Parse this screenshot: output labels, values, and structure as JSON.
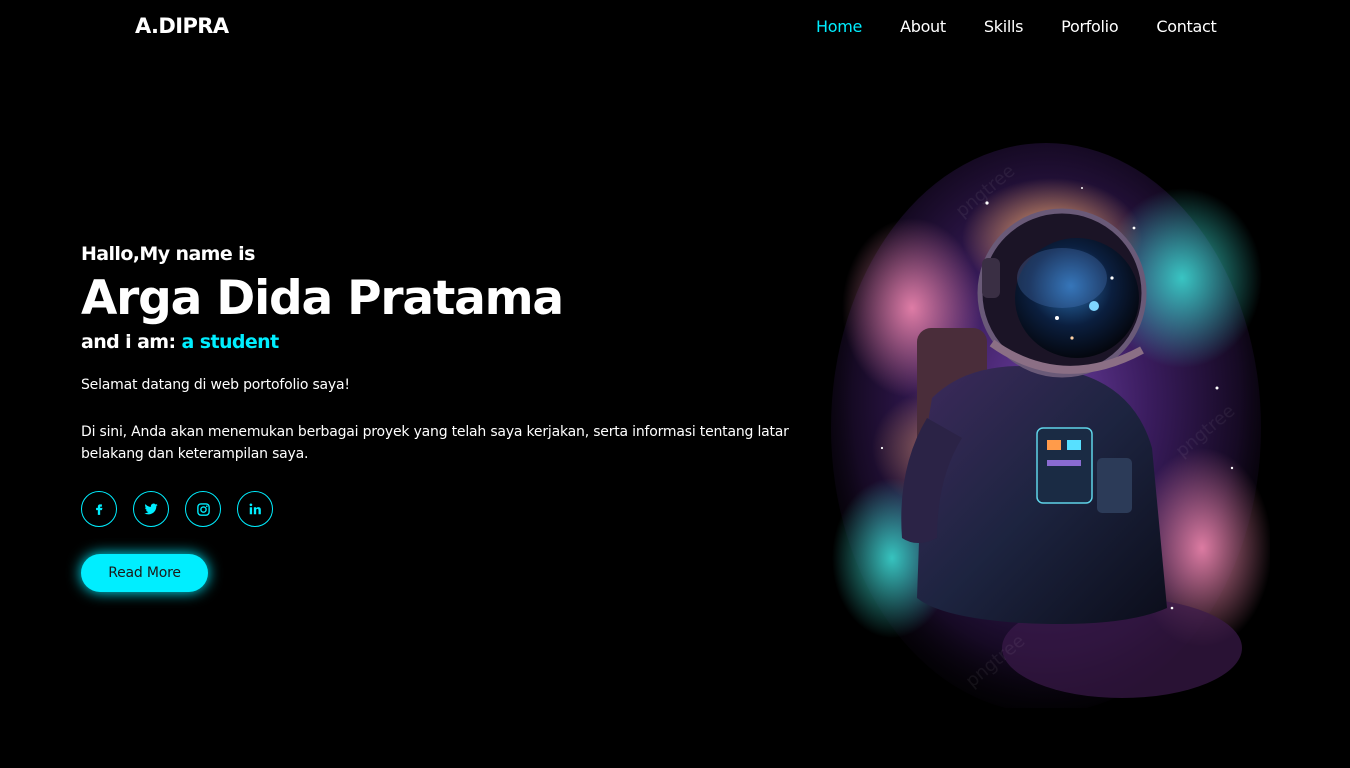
{
  "header": {
    "logo": "A.DIPRA",
    "nav": [
      {
        "label": "Home",
        "active": true
      },
      {
        "label": "About",
        "active": false
      },
      {
        "label": "Skills",
        "active": false
      },
      {
        "label": "Porfolio",
        "active": false
      },
      {
        "label": "Contact",
        "active": false
      }
    ]
  },
  "hero": {
    "greeting": "Hallo,My name is",
    "name": "Arga Dida Pratama",
    "role_prefix": "and i am:",
    "role": "a student",
    "welcome": "Selamat datang di web portofolio saya!",
    "description": "Di sini, Anda akan menemukan berbagai proyek yang telah saya kerjakan, serta informasi tentang latar belakang dan keterampilan saya.",
    "social": [
      {
        "icon": "facebook-icon"
      },
      {
        "icon": "twitter-icon"
      },
      {
        "icon": "instagram-icon"
      },
      {
        "icon": "linkedin-icon"
      }
    ],
    "cta_label": "Read More"
  },
  "theme": {
    "accent": "#00eeff",
    "background": "#000000",
    "text": "#ffffff"
  },
  "image": {
    "subject": "astronaut-illustration",
    "watermark": "pngtree"
  }
}
